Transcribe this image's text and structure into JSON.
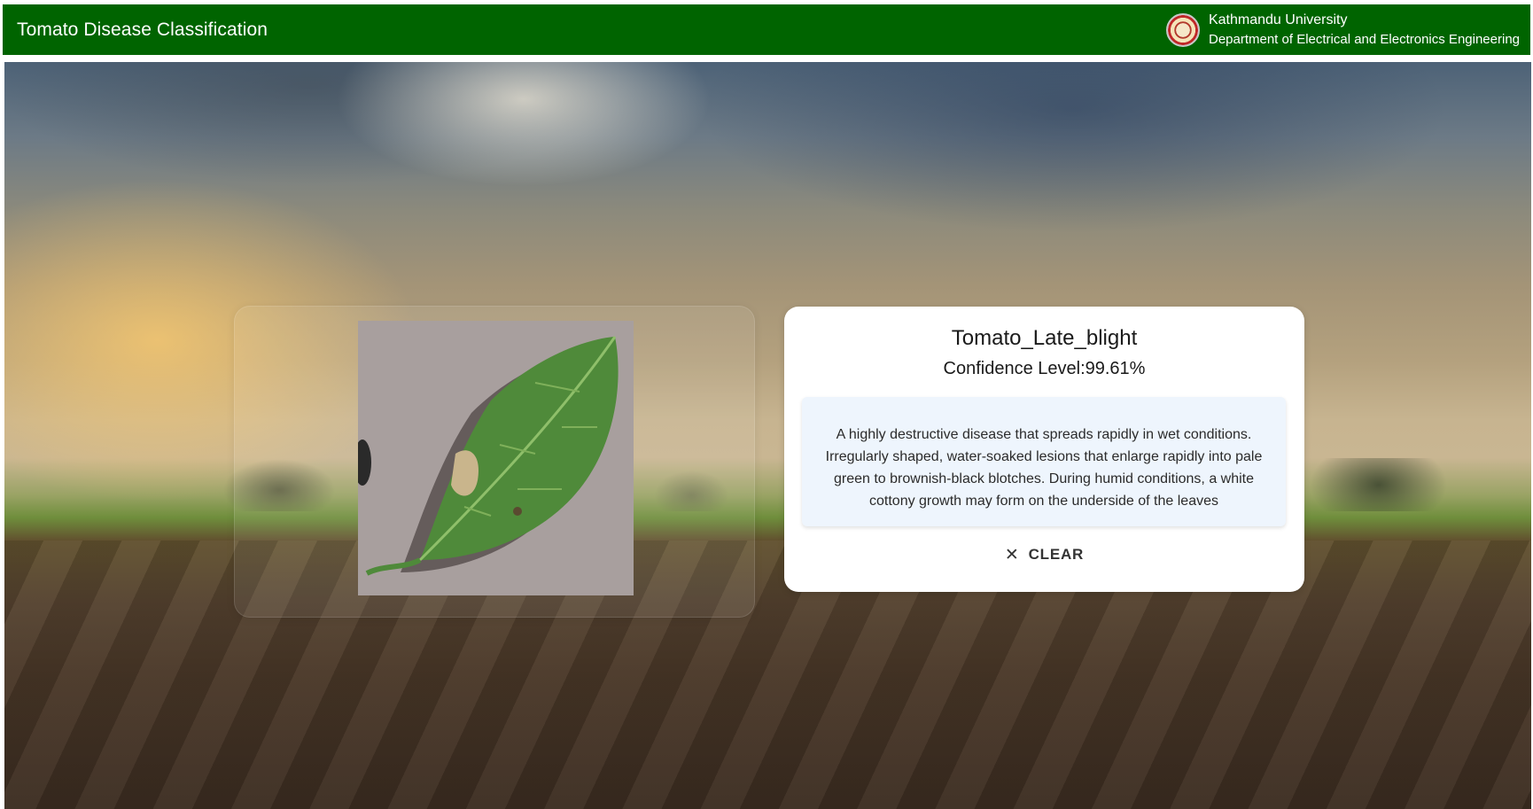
{
  "header": {
    "title": "Tomato Disease Classification",
    "university": "Kathmandu University",
    "department": "Department of Electrical and Electronics Engineering",
    "logo_icon": "university-seal-logo",
    "background_color": "#006400"
  },
  "upload": {
    "image_description_icon": "tomato-leaf-photo"
  },
  "result": {
    "disease": "Tomato_Late_blight",
    "confidence_label": "Confidence Level:",
    "confidence_value": "99.61%",
    "description": "A highly destructive disease that spreads rapidly in wet conditions. Irregularly shaped, water-soaked lesions that enlarge rapidly into pale green to brownish-black blotches. During humid conditions, a white cottony growth may form on the underside of the leaves",
    "clear_label": "CLEAR",
    "clear_icon": "close-icon"
  }
}
